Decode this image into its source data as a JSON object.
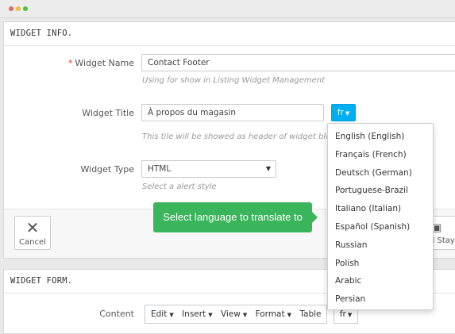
{
  "widget_info": {
    "heading": "WIDGET INFO.",
    "name_label": "Widget Name",
    "name_required": "*",
    "name_value": "Contact Footer",
    "name_help": "Using for show in Listing Widget Management",
    "title_label": "Widget Title",
    "title_value": "À propos du magasin",
    "title_help": "This tile will be showed as header of widget block",
    "lang_button": "fr",
    "type_label": "Widget Type",
    "type_value": "HTML",
    "type_help": "Select a alert style"
  },
  "language_dropdown": {
    "items": [
      "English (English)",
      "Français (French)",
      "Deutsch (German)",
      "Portuguese-Brazil",
      "Italiano (Italian)",
      "Español (Spanish)",
      "Russian",
      "Polish",
      "Arabic",
      "Persian"
    ]
  },
  "tooltip": {
    "text": "Select language to translate to",
    "color": "#3bb55c"
  },
  "footer": {
    "cancel_label": "Cancel",
    "save_stay_label": "d Stay"
  },
  "widget_form": {
    "heading": "WIDGET FORM.",
    "content_label": "Content",
    "toolbar": [
      "Edit",
      "Insert",
      "View",
      "Format",
      "Table"
    ],
    "lang_button": "fr"
  },
  "colors": {
    "accent": "#00aff0",
    "required": "#ee3333"
  }
}
